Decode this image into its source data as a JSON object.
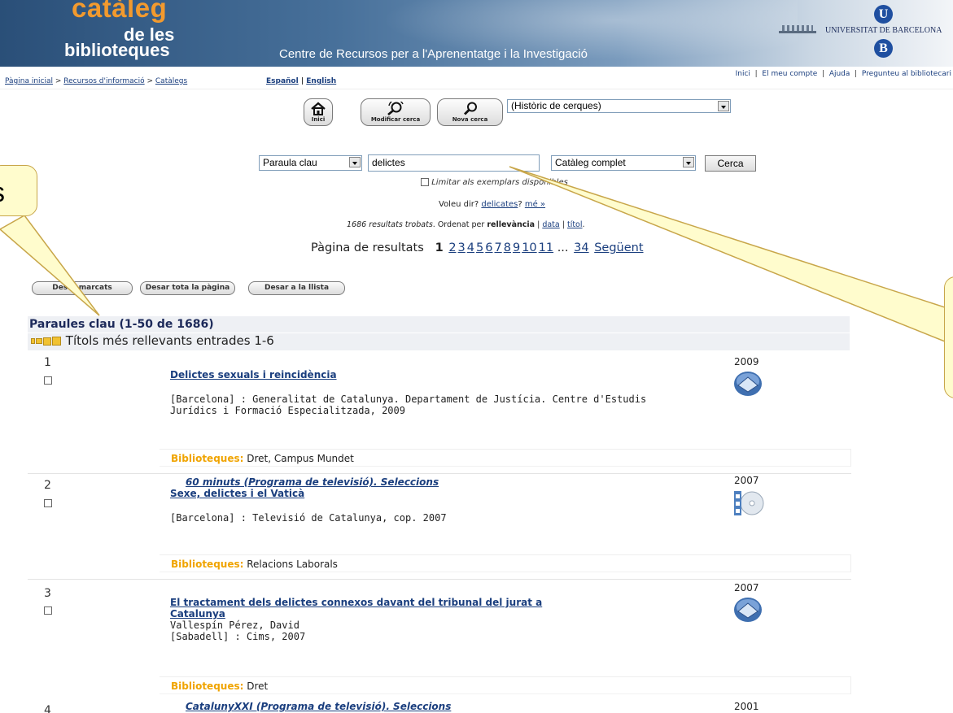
{
  "banner": {
    "logo_line1": "catàleg",
    "logo_line2": "de les",
    "logo_line3": "biblioteques",
    "subtitle": "Centre de Recursos per a l'Aprenentatge i la Investigació",
    "university": "UNIVERSITAT DE BARCELONA",
    "ub_u": "U",
    "ub_b": "B"
  },
  "nav": {
    "breadcrumb": [
      "Pàgina inicial",
      "Recursos d'informació",
      "Catàlegs"
    ],
    "breadcrumb_sep": " > ",
    "lang": [
      "Español",
      "English"
    ],
    "top_links": [
      "Inici",
      "El meu compte",
      "Ajuda",
      "Pregunteu al bibliotecari"
    ]
  },
  "toolbar": {
    "home_label": "Inici",
    "modify_label": "Modificar cerca",
    "new_label": "Nova cerca",
    "history_value": "(Històric de cerques)"
  },
  "search": {
    "field_value": "Paraula clau",
    "query": "delictes",
    "scope_value": "Catàleg complet",
    "submit": "Cerca",
    "limit_label": "Limitar als exemplars disponibles",
    "didyou_prefix": "Voleu dir?",
    "didyou_suggestion": "delicates",
    "didyou_q": "?",
    "didyou_more": "mé »"
  },
  "sorting": {
    "count_text": "1686 resultats trobats",
    "sort_prefix": ". Ordenat per ",
    "sort_active": "rellevància",
    "sort_data": "data",
    "sort_title": "títol",
    "sep": " | ",
    "end": "."
  },
  "pager": {
    "label": "Pàgina de resultats",
    "current": "1",
    "pages": [
      "2",
      "3",
      "4",
      "5",
      "6",
      "7",
      "8",
      "9",
      "10",
      "11"
    ],
    "ellipsis": "...",
    "last": "34",
    "next": "Següent"
  },
  "actions": {
    "save_marked": "Desar marcats",
    "save_page": "Desar tota la pàgina",
    "save_list": "Desar a la llista"
  },
  "results": {
    "header": "Paraules clau (1-50 de 1686)",
    "relevance_row": "Títols més rellevants entrades 1-6",
    "lib_label": "Biblioteques:",
    "records": [
      {
        "num": "1",
        "pre_title": "",
        "title": "Delictes sexuals i reincidència",
        "lines": [
          "[Barcelona] : Generalitat de Catalunya. Departament de Justícia. Centre d'Estudis",
          "Jurídics i Formació Especialitzada, 2009"
        ],
        "year": "2009",
        "icon": "book-icon",
        "libs": "Dret, Campus Mundet"
      },
      {
        "num": "2",
        "pre_title": "60 minuts (Programa de televisió). Seleccions",
        "title": "Sexe, delictes i el Vaticà",
        "lines": [
          "[Barcelona] : Televisió de Catalunya, cop. 2007"
        ],
        "year": "2007",
        "icon": "video-disc-icon",
        "libs": "Relacions Laborals"
      },
      {
        "num": "3",
        "pre_title": "",
        "title_l1": "El tractament dels delictes connexos davant del tribunal del jurat a",
        "title_l2": "Catalunya",
        "lines": [
          "Vallespín Pérez, David",
          "[Sabadell] : Cims, 2007"
        ],
        "year": "2007",
        "icon": "book-icon",
        "libs": "Dret"
      },
      {
        "num": "4",
        "pre_title": "CatalunyXXI (Programa de televisió). Seleccions",
        "year": "2001"
      }
    ]
  },
  "callout_left_text": "s",
  "colors": {
    "link": "#1a3e7e",
    "logo_orange": "#f29a2e",
    "lib_label": "#f0a400",
    "callout_fill": "#fffccd"
  }
}
